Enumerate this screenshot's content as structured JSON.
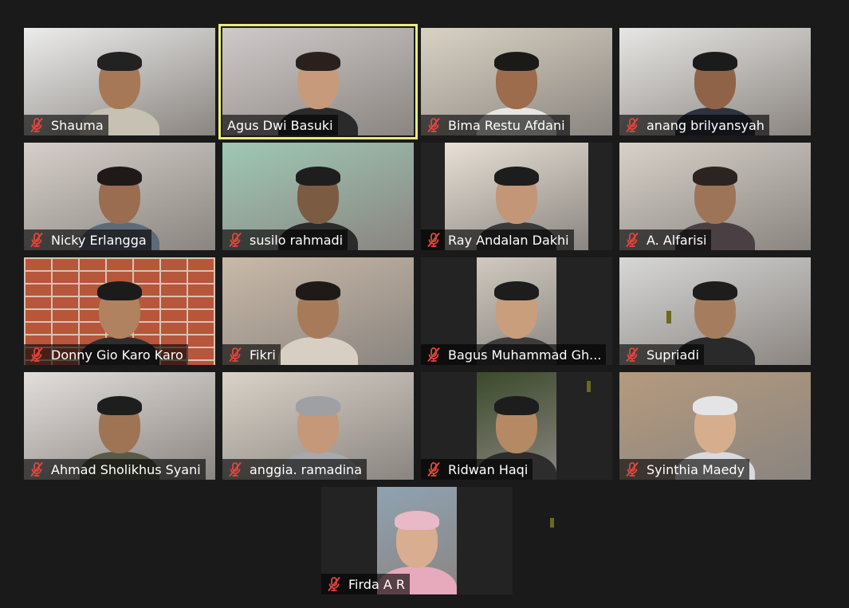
{
  "meeting": {
    "participants": [
      {
        "name": "Shauma",
        "muted": true,
        "active": false,
        "bg": "#ececec",
        "skin": "#a67855",
        "hair": "#222",
        "shirt": "#c7c1b4"
      },
      {
        "name": "Agus Dwi Basuki",
        "muted": false,
        "active": true,
        "bg": "#cfcaca",
        "skin": "#c89a7c",
        "hair": "#2a211c",
        "shirt": "#2a2a2a"
      },
      {
        "name": "Bima Restu Afdani",
        "muted": true,
        "active": false,
        "bg": "#d9d2c4",
        "skin": "#9c6c4c",
        "hair": "#1c1a18",
        "shirt": "#e8e6e2"
      },
      {
        "name": "anang brilyansyah",
        "muted": true,
        "active": false,
        "bg": "#e7e6e4",
        "skin": "#8f6347",
        "hair": "#1b1b1b",
        "shirt": "#2e3240"
      },
      {
        "name": "Nicky Erlangga",
        "muted": true,
        "active": false,
        "bg": "#d6cfc9",
        "skin": "#9a6d51",
        "hair": "#1f1a18",
        "shirt": "#5f6a78"
      },
      {
        "name": "susilo rahmadi",
        "muted": true,
        "active": false,
        "bg": "#9fc8b4",
        "skin": "#7b5b42",
        "hair": "#1e1e1e",
        "shirt": "#2b2b2b"
      },
      {
        "name": "Ray Andalan Dakhi",
        "muted": true,
        "active": false,
        "bg": "#e8e0d6",
        "skin": "#c29676",
        "hair": "#1d1d1d",
        "shirt": "#3a3a3a"
      },
      {
        "name": "A. Alfarisi",
        "muted": true,
        "active": false,
        "bg": "#d7d1c9",
        "skin": "#9d7457",
        "hair": "#2b2420",
        "shirt": "#4a4043"
      },
      {
        "name": "Donny Gio Karo Karo",
        "muted": true,
        "active": false,
        "bg": "brick",
        "skin": "#b0825f",
        "hair": "#1b1b1b",
        "shirt": "#2d2d2d"
      },
      {
        "name": "Fikri",
        "muted": true,
        "active": false,
        "bg": "#c9b9a8",
        "skin": "#a77b5a",
        "hair": "#1e1a17",
        "shirt": "#d8cfc4"
      },
      {
        "name": "Bagus Muhammad Gh...",
        "muted": true,
        "active": false,
        "bg": "#cfc9bf",
        "skin": "#c99e7d",
        "hair": "#1d1d1d",
        "shirt": "#3c3c3c"
      },
      {
        "name": "Supriadi",
        "muted": true,
        "active": false,
        "bg": "#d7d7d7",
        "skin": "#a57d5e",
        "hair": "#1d1d1d",
        "shirt": "#2a2a2a"
      },
      {
        "name": "Ahmad Sholikhus Syani",
        "muted": true,
        "active": false,
        "bg": "#e2dedb",
        "skin": "#9e7455",
        "hair": "#1e1e1e",
        "shirt": "#5a5a4a"
      },
      {
        "name": "anggia. ramadina",
        "muted": true,
        "active": false,
        "bg": "#d9d2c8",
        "skin": "#c49878",
        "hair": "#9ea0a4",
        "shirt": "#a7a9ad"
      },
      {
        "name": "Ridwan Haqi",
        "muted": true,
        "active": false,
        "bg": "#3b4a2b",
        "skin": "#b58963",
        "hair": "#1d1d1d",
        "shirt": "#2d2d2d"
      },
      {
        "name": "Syinthia Maedy",
        "muted": true,
        "active": false,
        "bg": "#b59a7e",
        "skin": "#d6ad8d",
        "hair": "#e4e4e6",
        "shirt": "#d9dadd"
      },
      {
        "name": "Firda A R",
        "muted": true,
        "active": false,
        "bg": "#8fa2b2",
        "skin": "#d9ae90",
        "hair": "#e9b9c8",
        "shirt": "#e7a9bc"
      }
    ]
  }
}
